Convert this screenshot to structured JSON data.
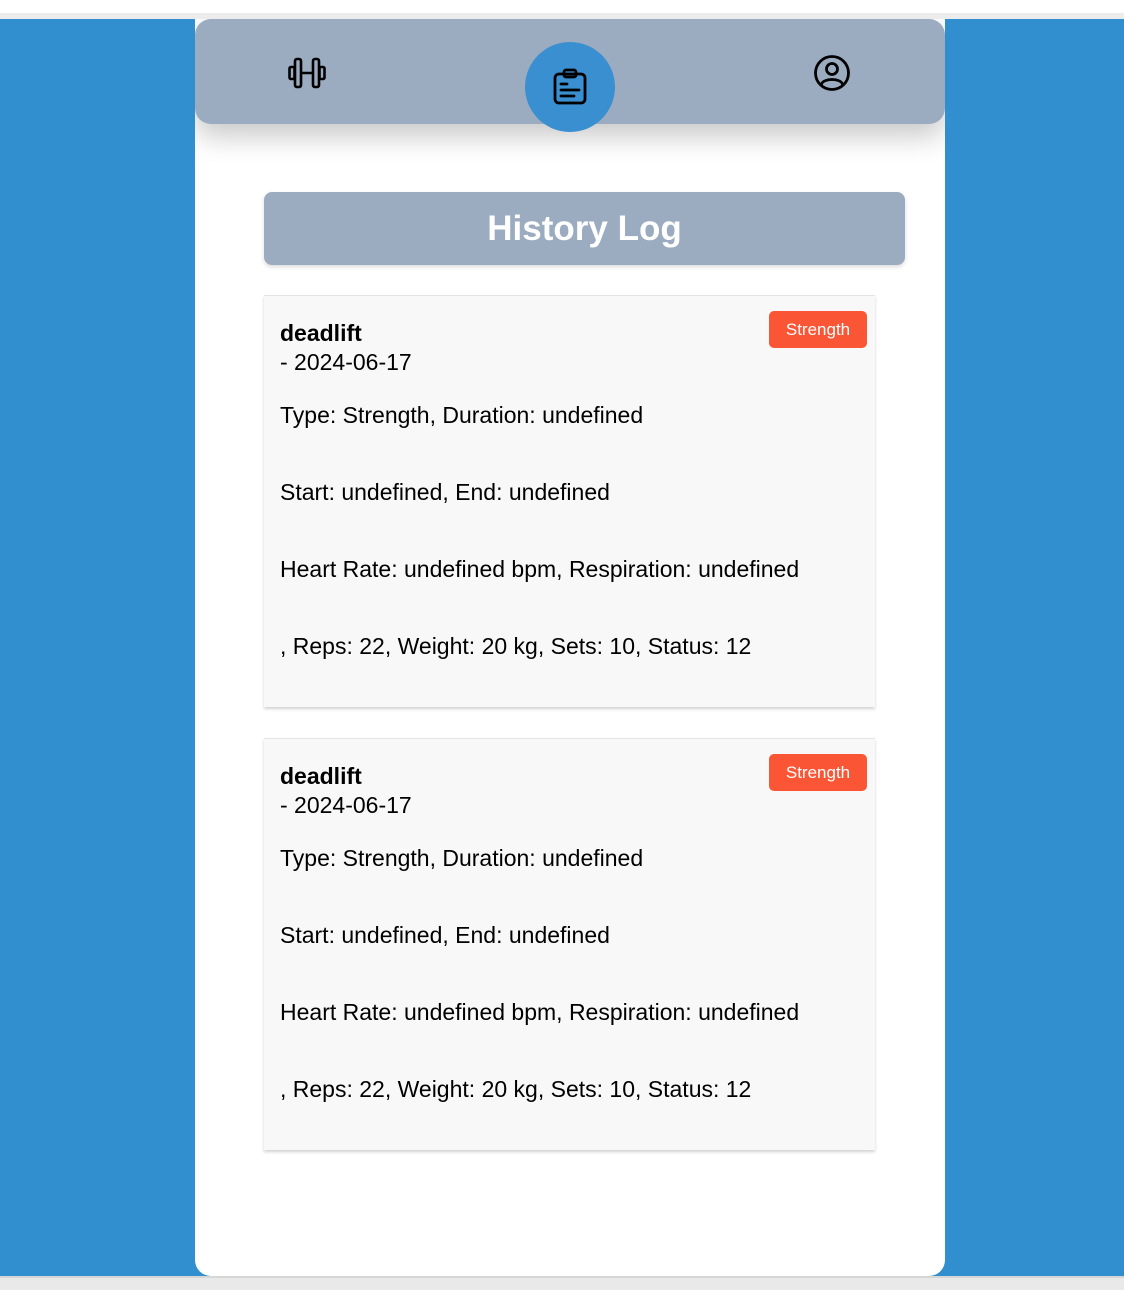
{
  "colors": {
    "background": "#318fcf",
    "nav_bar": "#9bacc0",
    "active_nav": "#3a8fd0",
    "badge": "#fa5535",
    "card": "#f8f8f8"
  },
  "nav": {
    "items": [
      {
        "icon": "dumbbell-icon",
        "active": false
      },
      {
        "icon": "clipboard-list-icon",
        "active": true
      },
      {
        "icon": "user-circle-icon",
        "active": false
      }
    ]
  },
  "header": {
    "title": "History Log"
  },
  "entries": [
    {
      "name": "deadlift",
      "date": "- 2024-06-17",
      "badge": "Strength",
      "line1": "Type: Strength, Duration: undefined",
      "line2": "Start: undefined, End: undefined",
      "line3": "Heart Rate: undefined bpm, Respiration: undefined",
      "line4": ", Reps: 22, Weight: 20 kg, Sets: 10, Status: 12"
    },
    {
      "name": "deadlift",
      "date": "- 2024-06-17",
      "badge": "Strength",
      "line1": "Type: Strength, Duration: undefined",
      "line2": "Start: undefined, End: undefined",
      "line3": "Heart Rate: undefined bpm, Respiration: undefined",
      "line4": ", Reps: 22, Weight: 20 kg, Sets: 10, Status: 12"
    }
  ]
}
